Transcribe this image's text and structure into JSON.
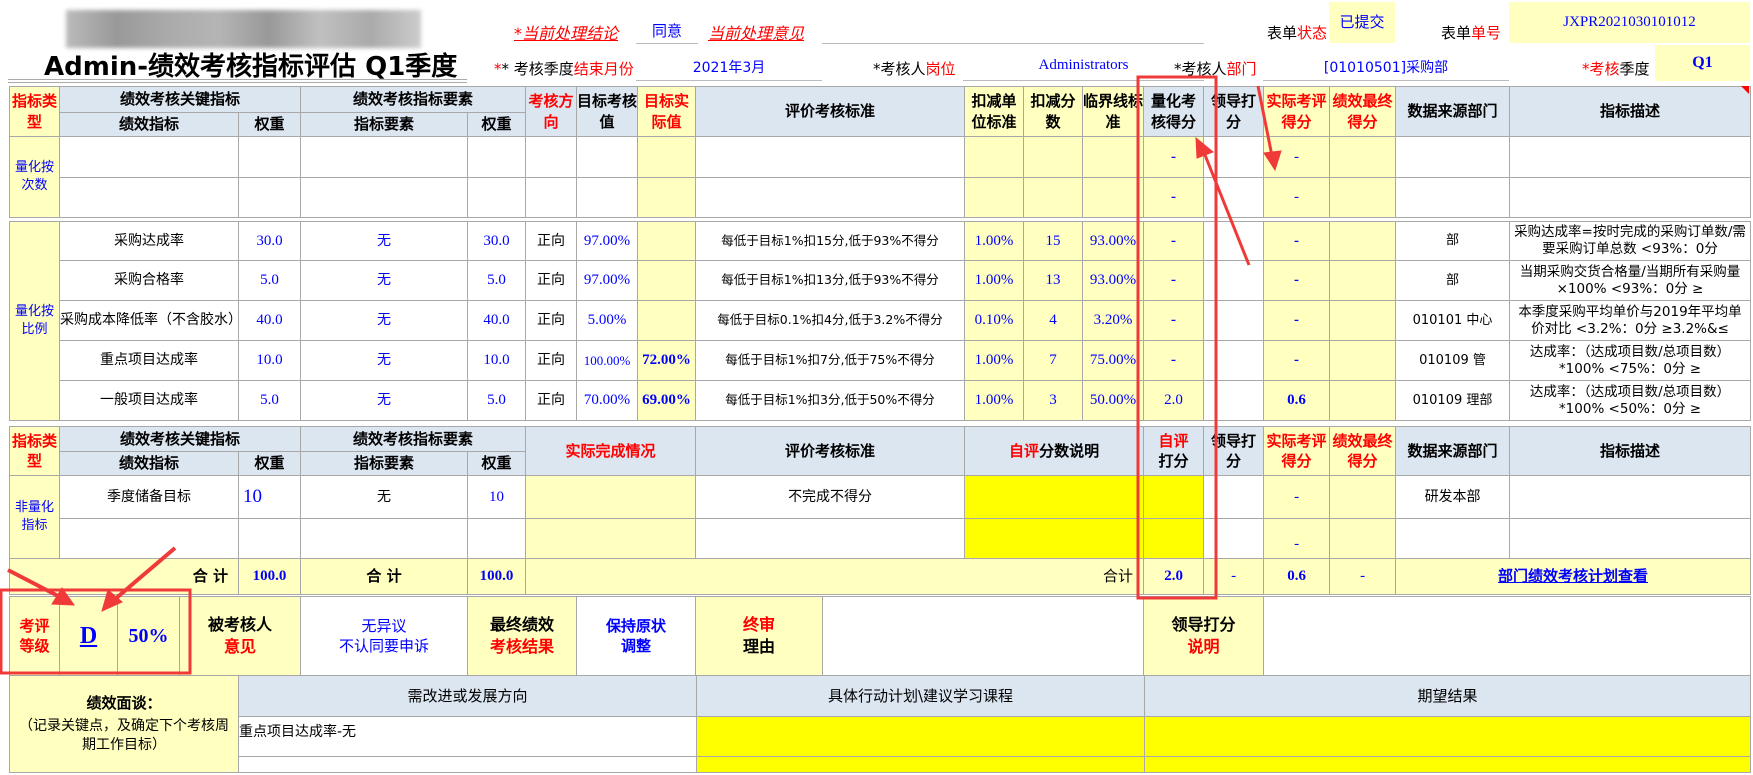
{
  "header": {
    "title": "Admin-绩效考核指标评估 Q1季度",
    "current_conclusion_label": "*当前处理结论",
    "current_conclusion_value": "同意",
    "current_opinion_label": "当前处理意见",
    "form_status_label_a": "表单",
    "form_status_label_b": "状态",
    "form_status_value": "已提交",
    "form_no_label_a": "表单",
    "form_no_label_b": "单号",
    "form_no_value": "JXPR2021030101012",
    "end_month_label_a": "* 考核季度",
    "end_month_label_b": "结束月份",
    "end_month_value": "2021年3月",
    "position_label_a": "*考核人",
    "position_label_b": "岗位",
    "position_value": "Administrators",
    "dept_label_a": "*考核人",
    "dept_label_b": "部门",
    "dept_value": "[01010501]采购部",
    "quarter_label_a": "*考核",
    "quarter_label_b": "季度",
    "quarter_value": "Q1"
  },
  "columns": {
    "type": "指标类型",
    "kpi_group": "绩效考核关键指标",
    "element_group": "绩效考核指标要素",
    "kpi": "绩效指标",
    "weight": "权重",
    "element": "指标要素",
    "direction": "考核方向",
    "target": "目标考核值",
    "actual": "目标实际值",
    "criteria": "评价考核标准",
    "deduct_unit": "扣减单位标准",
    "deduct_points": "扣减分数",
    "threshold": "临界线标准",
    "quant_score": "量化考核得分",
    "leader_score": "领导打分",
    "actual_score": "实际考评得分",
    "final_score": "绩效最终得分",
    "source_dept": "数据来源部门",
    "description": "指标描述",
    "actual_completion": "实际完成情况",
    "self_note_a": "自评",
    "self_note_b": "分数说明",
    "self_score_a": "自评",
    "self_score_b": "打分"
  },
  "quant_count": {
    "type_label": "量化按次数",
    "rows": [
      {
        "quant_score": "-",
        "actual_score": "-"
      },
      {
        "quant_score": "-",
        "actual_score": "-"
      }
    ]
  },
  "quant_ratio": {
    "type_label": "量化按比例",
    "rows": [
      {
        "kpi": "采购达成率",
        "weight": "30.0",
        "element": "无",
        "element_weight": "30.0",
        "direction": "正向",
        "target": "97.00%",
        "actual": "",
        "criteria": "每低于目标1%扣15分,低于93%不得分",
        "deduct_unit": "1.00%",
        "deduct_points": "15",
        "threshold": "93.00%",
        "quant_score": "-",
        "leader_score": "",
        "actual_score": "-",
        "final_score": "",
        "source_dept": "部",
        "description": "采购达成率=按时完成的采购订单数/需要采购订单总数 <93%：0分"
      },
      {
        "kpi": "采购合格率",
        "weight": "5.0",
        "element": "无",
        "element_weight": "5.0",
        "direction": "正向",
        "target": "97.00%",
        "actual": "",
        "criteria": "每低于目标1%扣13分,低于93%不得分",
        "deduct_unit": "1.00%",
        "deduct_points": "13",
        "threshold": "93.00%",
        "quant_score": "-",
        "leader_score": "",
        "actual_score": "-",
        "final_score": "",
        "source_dept": "部",
        "description": "当期采购交货合格量/当期所有采购量×100% <93%：0分 ≥"
      },
      {
        "kpi": "采购成本降低率（不含胶水）",
        "weight": "40.0",
        "element": "无",
        "element_weight": "40.0",
        "direction": "正向",
        "target": "5.00%",
        "actual": "",
        "criteria": "每低于目标0.1%扣4分,低于3.2%不得分",
        "deduct_unit": "0.10%",
        "deduct_points": "4",
        "threshold": "3.20%",
        "quant_score": "-",
        "leader_score": "",
        "actual_score": "-",
        "final_score": "",
        "source_dept": "010101 中心",
        "description": "本季度采购平均单价与2019年平均单价对比 <3.2%：0分 ≥3.2%&≤"
      },
      {
        "kpi": "重点项目达成率",
        "weight": "10.0",
        "element": "无",
        "element_weight": "10.0",
        "direction": "正向",
        "target": "100.00%",
        "actual": "72.00%",
        "criteria": "每低于目标1%扣7分,低于75%不得分",
        "deduct_unit": "1.00%",
        "deduct_points": "7",
        "threshold": "75.00%",
        "quant_score": "-",
        "leader_score": "",
        "actual_score": "-",
        "final_score": "",
        "source_dept": "010109 管",
        "description": "达成率：（达成项目数/总项目数）*100% <75%：0分 ≥"
      },
      {
        "kpi": "一般项目达成率",
        "weight": "5.0",
        "element": "无",
        "element_weight": "5.0",
        "direction": "正向",
        "target": "70.00%",
        "actual": "69.00%",
        "criteria": "每低于目标1%扣3分,低于50%不得分",
        "deduct_unit": "1.00%",
        "deduct_points": "3",
        "threshold": "50.00%",
        "quant_score": "2.0",
        "leader_score": "",
        "actual_score": "0.6",
        "final_score": "",
        "source_dept": "010109 理部",
        "description": "达成率：（达成项目数/总项目数）*100% <50%：0分 ≥"
      }
    ]
  },
  "non_quant": {
    "type_label": "非量化指标",
    "rows": [
      {
        "kpi": "季度储备目标",
        "weight": "10",
        "element": "无",
        "element_weight": "10",
        "criteria": "不完成不得分",
        "actual_score": "-",
        "source_dept": "研发本部"
      },
      {
        "kpi": "",
        "weight": "",
        "element": "",
        "element_weight": "",
        "criteria": "",
        "actual_score": "-",
        "source_dept": ""
      }
    ]
  },
  "totals": {
    "label": "合 计",
    "weight_total": "100.0",
    "element_weight_total": "100.0",
    "score_label": "合计",
    "self_score": "2.0",
    "leader_score": "-",
    "actual_score": "0.6",
    "final_score": "-",
    "plan_link": "部门绩效考核计划查看"
  },
  "result": {
    "grade_label_a": "考评",
    "grade_label_b": "等级",
    "grade": "D",
    "grade_percent": "50%",
    "appraisee_label_a": "被考核人",
    "appraisee_label_b": "意见",
    "appraisee_opinion_a": "无异议",
    "appraisee_opinion_b": "不认同要申诉",
    "final_result_label_a": "最终绩效",
    "final_result_label_b": "考核结果",
    "final_result_a": "保持原状",
    "final_result_b": "调整",
    "final_review_label_a": "终审",
    "final_review_label_b": "理由",
    "leader_note_label_a": "领导打分",
    "leader_note_label_b": "说明"
  },
  "interview": {
    "label": "绩效面谈：",
    "hint": "（记录关键点，及确定下个考核周期工作目标）",
    "col_improve": "需改进或发展方向",
    "col_plan": "具体行动计划\\建议学习课程",
    "col_expect": "期望结果",
    "rows": [
      {
        "improve": "重点项目达成率-无",
        "plan": "",
        "expect": ""
      },
      {
        "improve": "",
        "plan": "",
        "expect": ""
      }
    ]
  },
  "colors": {
    "header_blue": "#dce6f1",
    "pale_yellow": "#ffffc0",
    "bright_yellow": "#ffff00",
    "accent_red": "#ff0000",
    "value_blue": "#0000ff",
    "annotation_red": "#f03a3a"
  }
}
